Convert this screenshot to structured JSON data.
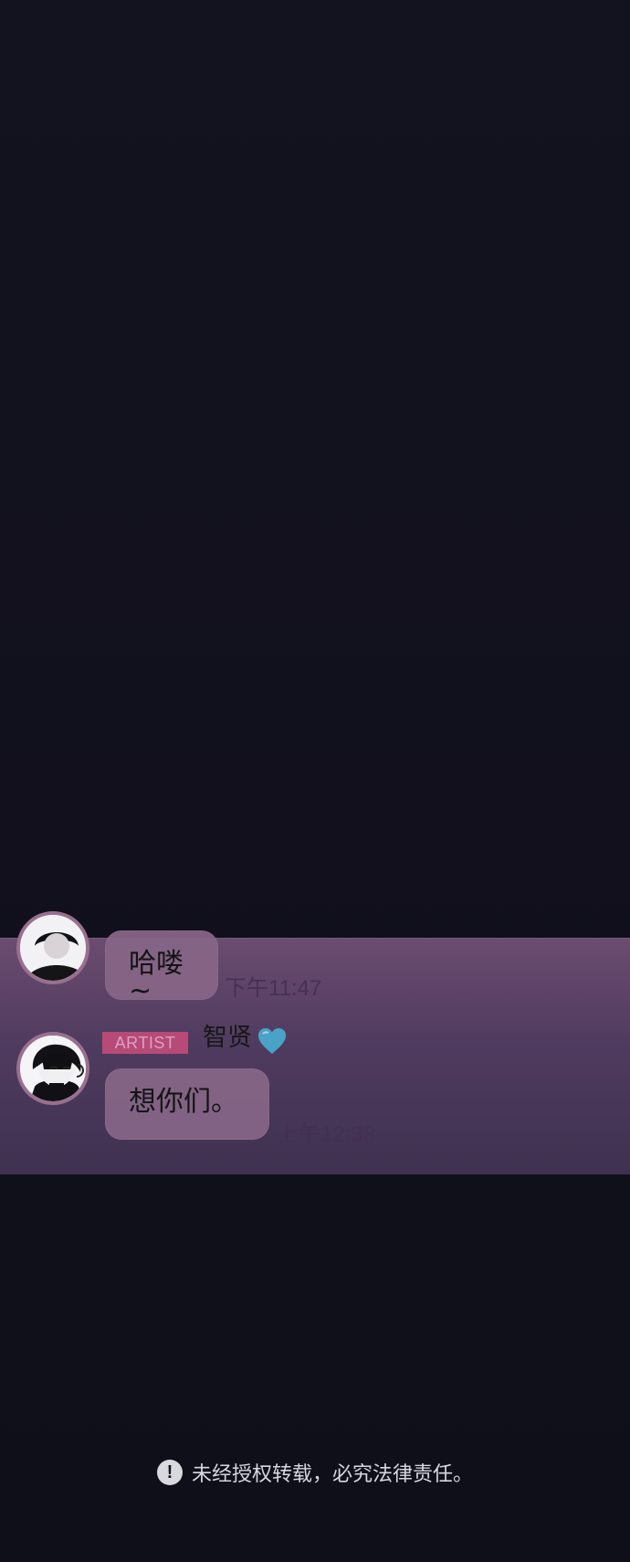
{
  "chat": {
    "message_1": {
      "text": "哈喽~",
      "time": "下午11:47"
    },
    "artist_label": "ARTIST",
    "name": "智贤",
    "message_2": {
      "text": "想你们。",
      "time": "上午12:38"
    }
  },
  "footer": {
    "notice": "未经授权转载，必究法律责任。",
    "icon": "warning-icon"
  },
  "colors": {
    "background": "#0f0f1a",
    "panel_top": "#6b4c6f",
    "panel_bottom": "#3f3150",
    "bubble": "#866587",
    "badge": "#b84a78",
    "heart": "#4aa3c7"
  }
}
